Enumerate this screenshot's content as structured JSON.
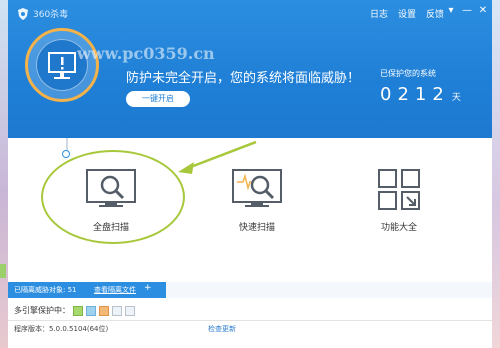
{
  "app": {
    "title": "360杀毒",
    "top_links": [
      "日志",
      "设置",
      "反馈"
    ],
    "window_buttons": [
      "▾",
      "—",
      "✕"
    ]
  },
  "header": {
    "watermark": "www.pc0359.cn",
    "status_title": "防护未完全开启，您的系统将面临威胁！",
    "enable_button": "一键开启",
    "days_label": "已保护您的系统",
    "days_value": "0212",
    "days_unit": "天"
  },
  "features": [
    {
      "label": "全盘扫描"
    },
    {
      "label": "快速扫描"
    },
    {
      "label": "功能大全"
    }
  ],
  "bottom": {
    "blocked_label": "已隔离威胁对象: 51",
    "view_files": "查看隔离文件",
    "add_sign": "+",
    "engine_label": "多引擎保护中："
  },
  "footer": {
    "version": "程序版本：5.0.0.5104(64位)",
    "check_update": "检查更新"
  },
  "colors": {
    "header_blue": "#1f7fd6",
    "accent_orange": "#f3b24a",
    "highlight_green": "#a7c83b"
  }
}
